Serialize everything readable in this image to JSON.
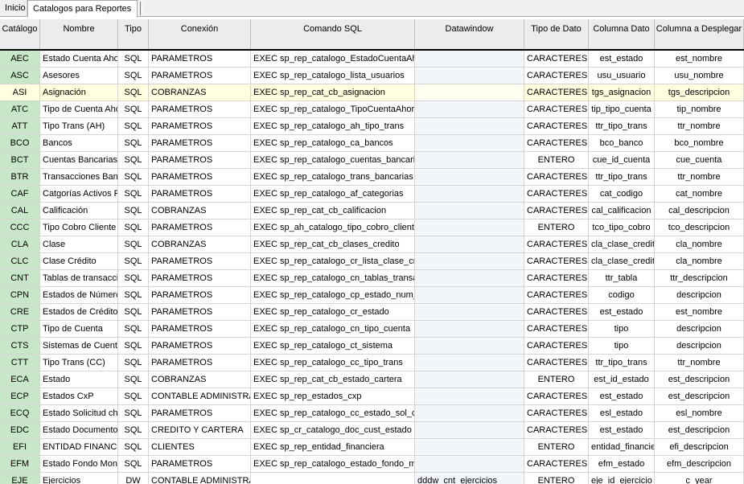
{
  "tabs": {
    "inicio": "Inicio",
    "catalogos": "Catalogos para Reportes"
  },
  "columns": {
    "catalogo": "Catálogo",
    "nombre": "Nombre",
    "tipo": "Tipo",
    "conexion": "Conexión",
    "comando": "Comando SQL",
    "datawindow": "Datawindow",
    "tipo_dato": "Tipo de Dato",
    "columna_dato": "Columna Dato",
    "columna_desplegar": "Columna a Desplegar"
  },
  "selected_row": 2,
  "rows": [
    {
      "c": "AEC",
      "n": "Estado Cuenta Ahorros",
      "t": "SQL",
      "cx": "PARAMETROS",
      "s": "EXEC sp_rep_catalogo_EstadoCuentaAhorro",
      "dw": "",
      "td": "CARACTERES",
      "cd": "est_estado",
      "cp": "est_nombre"
    },
    {
      "c": "ASC",
      "n": "Asesores",
      "t": "SQL",
      "cx": "PARAMETROS",
      "s": "EXEC sp_rep_catalogo_lista_usuarios",
      "dw": "",
      "td": "CARACTERES",
      "cd": "usu_usuario",
      "cp": "usu_nombre"
    },
    {
      "c": "ASI",
      "n": "Asignación",
      "t": "SQL",
      "cx": "COBRANZAS",
      "s": "EXEC sp_rep_cat_cb_asignacion",
      "dw": "",
      "td": "CARACTERES",
      "cd": "tgs_asignacion",
      "cp": "tgs_descripcion"
    },
    {
      "c": "ATC",
      "n": "Tipo de Cuenta Ahorros",
      "t": "SQL",
      "cx": "PARAMETROS",
      "s": "EXEC sp_rep_catalogo_TipoCuentaAhorro",
      "dw": "",
      "td": "CARACTERES",
      "cd": "tip_tipo_cuenta",
      "cp": "tip_nombre"
    },
    {
      "c": "ATT",
      "n": "Tipo Trans (AH)",
      "t": "SQL",
      "cx": "PARAMETROS",
      "s": "EXEC sp_rep_catalogo_ah_tipo_trans",
      "dw": "",
      "td": "CARACTERES",
      "cd": "ttr_tipo_trans",
      "cp": "ttr_nombre"
    },
    {
      "c": "BCO",
      "n": "Bancos",
      "t": "SQL",
      "cx": "PARAMETROS",
      "s": "EXEC sp_rep_catalogo_ca_bancos",
      "dw": "",
      "td": "CARACTERES",
      "cd": "bco_banco",
      "cp": "bco_nombre"
    },
    {
      "c": "BCT",
      "n": "Cuentas Bancarias",
      "t": "SQL",
      "cx": "PARAMETROS",
      "s": "EXEC sp_rep_catalogo_cuentas_bancarias",
      "dw": "",
      "td": "ENTERO",
      "cd": "cue_id_cuenta",
      "cp": "cue_cuenta"
    },
    {
      "c": "BTR",
      "n": "Transacciones Bancarias",
      "t": "SQL",
      "cx": "PARAMETROS",
      "s": "EXEC sp_rep_catalogo_trans_bancarias",
      "dw": "",
      "td": "CARACTERES",
      "cd": "ttr_tipo_trans",
      "cp": "ttr_nombre"
    },
    {
      "c": "CAF",
      "n": "Catgorías Activos Fijos",
      "t": "SQL",
      "cx": "PARAMETROS",
      "s": "EXEC sp_rep_catalogo_af_categorias",
      "dw": "",
      "td": "CARACTERES",
      "cd": "cat_codigo",
      "cp": "cat_nombre"
    },
    {
      "c": "CAL",
      "n": "Calificación",
      "t": "SQL",
      "cx": "COBRANZAS",
      "s": "EXEC sp_rep_cat_cb_calificacion",
      "dw": "",
      "td": "CARACTERES",
      "cd": "cal_calificacion",
      "cp": "cal_descripcion"
    },
    {
      "c": "CCC",
      "n": "Tipo Cobro Cliente",
      "t": "SQL",
      "cx": "PARAMETROS",
      "s": "EXEC sp_ah_catalogo_tipo_cobro_cliente",
      "dw": "",
      "td": "ENTERO",
      "cd": "tco_tipo_cobro",
      "cp": "tco_descripcion"
    },
    {
      "c": "CLA",
      "n": "Clase",
      "t": "SQL",
      "cx": "COBRANZAS",
      "s": "EXEC sp_rep_cat_cb_clases_credito",
      "dw": "",
      "td": "CARACTERES",
      "cd": "cla_clase_credito",
      "cp": "cla_nombre"
    },
    {
      "c": "CLC",
      "n": "Clase Crédito",
      "t": "SQL",
      "cx": "PARAMETROS",
      "s": "EXEC sp_rep_catalogo_cr_lista_clase_credito",
      "dw": "",
      "td": "CARACTERES",
      "cd": "cla_clase_credito",
      "cp": "cla_nombre"
    },
    {
      "c": "CNT",
      "n": "Tablas de transacciones",
      "t": "SQL",
      "cx": "PARAMETROS",
      "s": "EXEC sp_rep_catalogo_cn_tablas_transacciones",
      "dw": "",
      "td": "CARACTERES",
      "cd": "ttr_tabla",
      "cp": "ttr_descripcion"
    },
    {
      "c": "CPN",
      "n": "Estados de Número",
      "t": "SQL",
      "cx": "PARAMETROS",
      "s": "EXEC sp_rep_catalogo_cp_estado_num_cp",
      "dw": "",
      "td": "CARACTERES",
      "cd": "codigo",
      "cp": "descripcion"
    },
    {
      "c": "CRE",
      "n": "Estados de Crédito",
      "t": "SQL",
      "cx": "PARAMETROS",
      "s": "EXEC sp_rep_catalogo_cr_estado",
      "dw": "",
      "td": "CARACTERES",
      "cd": "est_estado",
      "cp": "est_nombre"
    },
    {
      "c": "CTP",
      "n": "Tipo de Cuenta",
      "t": "SQL",
      "cx": "PARAMETROS",
      "s": "EXEC sp_rep_catalogo_cn_tipo_cuenta",
      "dw": "",
      "td": "CARACTERES",
      "cd": "tipo",
      "cp": "descripcion"
    },
    {
      "c": "CTS",
      "n": "Sistemas de Cuenta",
      "t": "SQL",
      "cx": "PARAMETROS",
      "s": "EXEC sp_rep_catalogo_ct_sistema",
      "dw": "",
      "td": "CARACTERES",
      "cd": "tipo",
      "cp": "descripcion"
    },
    {
      "c": "CTT",
      "n": "Tipo Trans (CC)",
      "t": "SQL",
      "cx": "PARAMETROS",
      "s": "EXEC sp_rep_catalogo_cc_tipo_trans",
      "dw": "",
      "td": "CARACTERES",
      "cd": "ttr_tipo_trans",
      "cp": "ttr_nombre"
    },
    {
      "c": "ECA",
      "n": "Estado",
      "t": "SQL",
      "cx": "COBRANZAS",
      "s": "EXEC sp_rep_cat_cb_estado_cartera",
      "dw": "",
      "td": "ENTERO",
      "cd": "est_id_estado",
      "cp": "est_descripcion"
    },
    {
      "c": "ECP",
      "n": "Estados CxP",
      "t": "SQL",
      "cx": "CONTABLE ADMINISTRATIVO",
      "s": "EXEC sp_rep_estados_cxp",
      "dw": "",
      "td": "CARACTERES",
      "cd": "est_estado",
      "cp": "est_descripcion"
    },
    {
      "c": "ECQ",
      "n": "Estado Solicitud cheque",
      "t": "SQL",
      "cx": "PARAMETROS",
      "s": "EXEC sp_rep_catalogo_cc_estado_sol_cheque",
      "dw": "",
      "td": "CARACTERES",
      "cd": "esl_estado",
      "cp": "esl_nombre"
    },
    {
      "c": "EDC",
      "n": "Estado Documentos",
      "t": "SQL",
      "cx": "CREDITO Y CARTERA",
      "s": "EXEC sp_cr_catalogo_doc_cust_estado",
      "dw": "",
      "td": "CARACTERES",
      "cd": "est_estado",
      "cp": "est_descripcion"
    },
    {
      "c": "EFI",
      "n": "ENTIDAD FINANCIERA",
      "t": "SQL",
      "cx": "CLIENTES",
      "s": "EXEC sp_rep_entidad_financiera",
      "dw": "",
      "td": "ENTERO",
      "cd": "entidad_financiera",
      "cp": "efi_descripcion"
    },
    {
      "c": "EFM",
      "n": "Estado Fondo Monetario",
      "t": "SQL",
      "cx": "PARAMETROS",
      "s": "EXEC sp_rep_catalogo_estado_fondo_monetario",
      "dw": "",
      "td": "CARACTERES",
      "cd": "efm_estado",
      "cp": "efm_descripcion"
    },
    {
      "c": "EJE",
      "n": "Ejercicios",
      "t": "DW",
      "cx": "CONTABLE ADMINISTRATIVO",
      "s": "",
      "dw": "dddw_cnt_ejercicios",
      "td": "ENTERO",
      "cd": "eje_id_ejercicio",
      "cp": "c_year"
    }
  ]
}
